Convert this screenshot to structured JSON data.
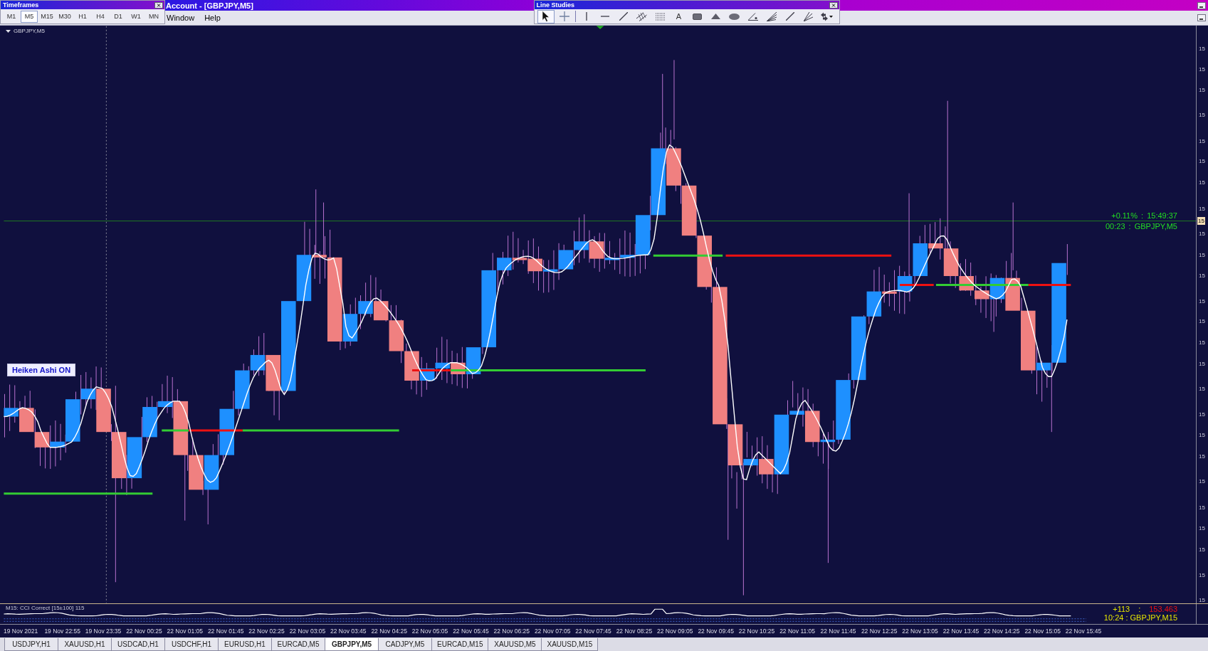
{
  "timeframes_toolbar": {
    "title": "Timeframes",
    "buttons": [
      {
        "label": "M1",
        "selected": false
      },
      {
        "label": "M5",
        "selected": true
      },
      {
        "label": "M15",
        "selected": false
      },
      {
        "label": "M30",
        "selected": false
      },
      {
        "label": "H1",
        "selected": false
      },
      {
        "label": "H4",
        "selected": false
      },
      {
        "label": "D1",
        "selected": false
      },
      {
        "label": "W1",
        "selected": false
      },
      {
        "label": "MN",
        "selected": false
      }
    ]
  },
  "window": {
    "title": "Account - [GBPJPY,M5]"
  },
  "menu": [
    "Window",
    "Help"
  ],
  "line_studies_toolbar": {
    "title": "Line Studies",
    "tools": [
      {
        "selected": true
      },
      {
        "selected": false
      },
      {
        "selected": false
      },
      {
        "selected": false
      },
      {
        "selected": false
      },
      {
        "selected": false
      },
      {
        "selected": false
      },
      {
        "label": "A",
        "selected": false
      },
      {
        "selected": false
      },
      {
        "selected": false
      },
      {
        "selected": false
      },
      {
        "selected": false
      },
      {
        "selected": false
      },
      {
        "selected": false
      },
      {
        "selected": false
      },
      {
        "selected": false
      }
    ]
  },
  "chart": {
    "symbol": "GBPJPY,M5",
    "overlay_label": "Heiken Ashi ON",
    "info_lines": [
      "+0.11% : 15:49:37",
      "00:23 : GBPJPY,M5"
    ],
    "price_axis_labels": [
      "15",
      "15",
      "15",
      "15",
      "15",
      "15",
      "15",
      "15",
      "15",
      "15",
      "15",
      "15",
      "15",
      "15",
      "15",
      "15",
      "15",
      "15",
      "15",
      "15",
      "15",
      "15",
      "15",
      "15",
      "15"
    ],
    "price_marker": "15"
  },
  "indicator": {
    "title": "M15: CCI Correct [15±100] 115",
    "reading": "+113",
    "separator": ":",
    "price": "153.463",
    "info": "10:24 : GBPJPY,M15"
  },
  "time_axis": [
    "19 Nov 2021",
    "19 Nov 22:55",
    "19 Nov 23:35",
    "22 Nov 00:25",
    "22 Nov 01:05",
    "22 Nov 01:45",
    "22 Nov 02:25",
    "22 Nov 03:05",
    "22 Nov 03:45",
    "22 Nov 04:25",
    "22 Nov 05:05",
    "22 Nov 05:45",
    "22 Nov 06:25",
    "22 Nov 07:05",
    "22 Nov 07:45",
    "22 Nov 08:25",
    "22 Nov 09:05",
    "22 Nov 09:45",
    "22 Nov 10:25",
    "22 Nov 11:05",
    "22 Nov 11:45",
    "22 Nov 12:25",
    "22 Nov 13:05",
    "22 Nov 13:45",
    "22 Nov 14:25",
    "22 Nov 15:05",
    "22 Nov 15:45"
  ],
  "symbol_tabs": [
    {
      "label": "USDJPY,H1",
      "selected": false
    },
    {
      "label": "XAUUSD,H1",
      "selected": false
    },
    {
      "label": "USDCAD,H1",
      "selected": false
    },
    {
      "label": "USDCHF,H1",
      "selected": false
    },
    {
      "label": "EURUSD,H1",
      "selected": false
    },
    {
      "label": "EURCAD,M5",
      "selected": false
    },
    {
      "label": "GBPJPY,M5",
      "selected": true
    },
    {
      "label": "CADJPY,M5",
      "selected": false
    },
    {
      "label": "EURCAD,M15",
      "selected": false
    },
    {
      "label": "XAUUSD,M5",
      "selected": false
    },
    {
      "label": "XAUUSD,M15",
      "selected": false
    }
  ]
}
